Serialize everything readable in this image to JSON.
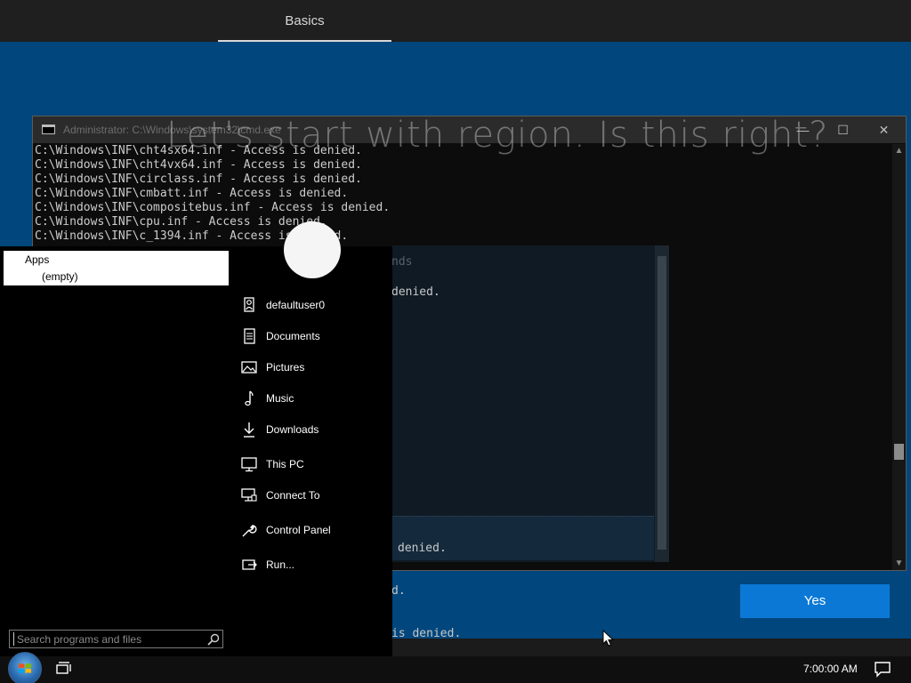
{
  "oobe": {
    "tab_label": "Basics",
    "heading": "Let's start with region. Is this right?",
    "yes_button": "Yes"
  },
  "console": {
    "title": "Administrator: C:\\Windows\\system32\\cmd.exe",
    "lines": [
      "C:\\Windows\\INF\\cht4sx64.inf - Access is denied.",
      "C:\\Windows\\INF\\cht4vx64.inf - Access is denied.",
      "C:\\Windows\\INF\\circlass.inf - Access is denied.",
      "C:\\Windows\\INF\\cmbatt.inf - Access is denied.",
      "C:\\Windows\\INF\\compositebus.inf - Access is denied.",
      "C:\\Windows\\INF\\cpu.inf - Access is denied.",
      "C:\\Windows\\INF\\c_1394.inf - Access is denied."
    ],
    "ghost": {
      "heading": "nds",
      "line1": "denied.",
      "bottom_lines": [
        "denied.",
        "d.",
        "is denied."
      ]
    }
  },
  "start_menu": {
    "apps_root": "Apps",
    "apps_empty": "(empty)",
    "places": [
      {
        "label": "defaultuser0",
        "icon": "user-icon"
      },
      {
        "label": "Documents",
        "icon": "document-icon"
      },
      {
        "label": "Pictures",
        "icon": "picture-icon"
      },
      {
        "label": "Music",
        "icon": "music-icon"
      },
      {
        "label": "Downloads",
        "icon": "download-icon"
      },
      {
        "label": "This PC",
        "icon": "computer-icon"
      },
      {
        "label": "Connect To",
        "icon": "network-icon"
      },
      {
        "label": "Control Panel",
        "icon": "wrench-icon"
      },
      {
        "label": "Run...",
        "icon": "run-icon"
      }
    ],
    "search_placeholder": "Search programs and files"
  },
  "taskbar": {
    "clock": "7:00:00 AM"
  }
}
